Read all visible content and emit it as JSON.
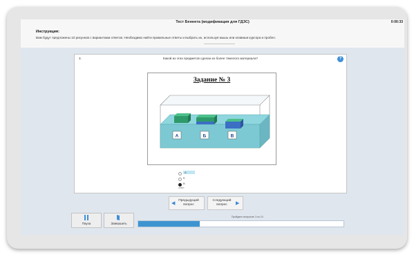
{
  "window": {
    "title": "Тест Беннета (модификация для ГДЗС)",
    "code": "0:00:33"
  },
  "instructions": {
    "label": "Инструкция:",
    "text": "Вам будут предложены 10 рисунков с вариантами ответов. Необходимо найти правильные ответы и выбрать их, используя мышь или клавиши курсора и пробел."
  },
  "question": {
    "number": "3.",
    "text": "Какой из этих предметов сделан из более тяжелого материала?",
    "help_icon": "help-icon",
    "image": {
      "task_title": "Задание № 3",
      "labels": [
        "А",
        "Б",
        "В"
      ]
    },
    "options": [
      {
        "label": "А",
        "selected": false
      },
      {
        "label": "Б",
        "selected": false
      },
      {
        "label": "В",
        "selected": true
      }
    ],
    "answer_note": "ответ"
  },
  "nav": {
    "prev_line1": "Предыдущий",
    "prev_line2": "вопрос",
    "next_line1": "Следующий",
    "next_line2": "вопрос"
  },
  "bottom": {
    "pause_label": "Пауза",
    "finish_label": "Завершить"
  },
  "progress": {
    "label": "Пройдено вопросов: 3 из 10",
    "fraction": 0.3,
    "color": "#3e94d0"
  }
}
